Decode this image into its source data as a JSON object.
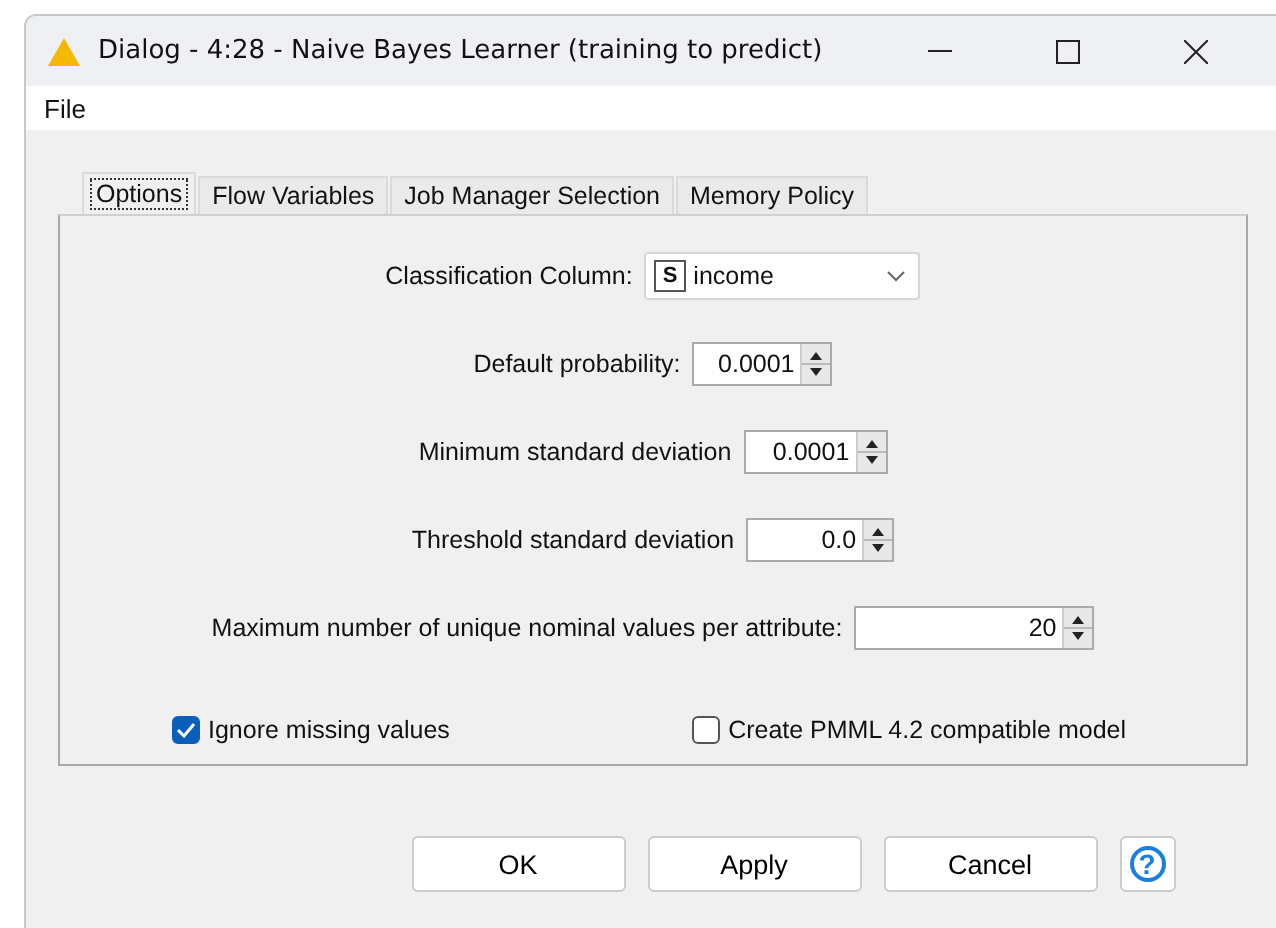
{
  "window": {
    "title": "Dialog - 4:28 - Naive Bayes Learner (training to predict)"
  },
  "menu": [
    "File"
  ],
  "tabs": [
    {
      "label": "Options",
      "selected": true
    },
    {
      "label": "Flow Variables",
      "selected": false
    },
    {
      "label": "Job Manager Selection",
      "selected": false
    },
    {
      "label": "Memory Policy",
      "selected": false
    }
  ],
  "fields": [
    {
      "kind": "dropdown",
      "label": "Classification Column:",
      "type_badge": "S",
      "value": "income"
    },
    {
      "kind": "spinner",
      "label": "Default probability:",
      "value": "0.0001"
    },
    {
      "kind": "spinner",
      "label": "Minimum standard deviation",
      "value": "0.0001"
    },
    {
      "kind": "spinner",
      "label": "Threshold standard deviation",
      "value": "0.0"
    },
    {
      "kind": "spinner",
      "label": "Maximum number of unique nominal values per attribute:",
      "value": "20"
    }
  ],
  "checkboxes": [
    {
      "label": "Ignore missing values",
      "checked": true
    },
    {
      "label": "Create PMML 4.2 compatible model",
      "checked": false
    }
  ],
  "buttons": [
    "OK",
    "Apply",
    "Cancel"
  ],
  "help": "?"
}
